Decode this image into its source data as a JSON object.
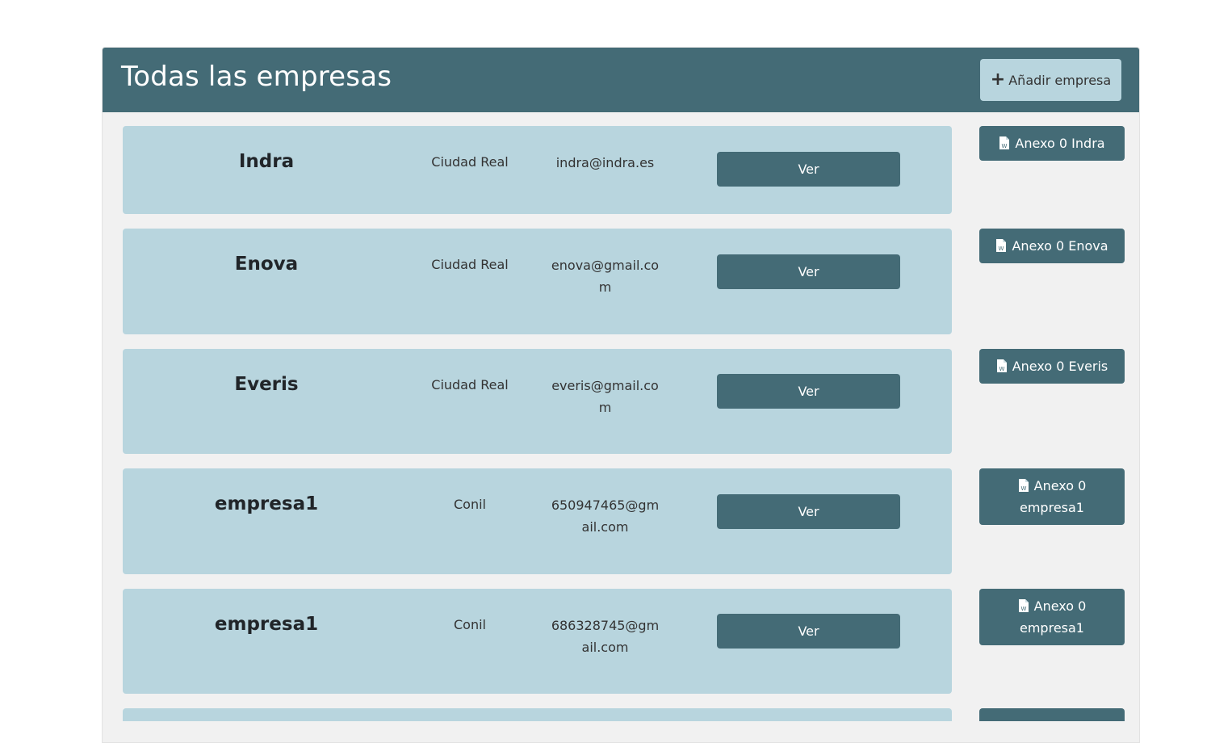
{
  "header": {
    "title": "Todas las empresas",
    "add_label": "Añadir empresa"
  },
  "companies": [
    {
      "name": "Indra",
      "city": "Ciudad Real",
      "email": "indra@indra.es",
      "view_label": "Ver",
      "annex_label": "Anexo 0 Indra"
    },
    {
      "name": "Enova",
      "city": "Ciudad Real",
      "email": "enova@gmail.com",
      "view_label": "Ver",
      "annex_label": "Anexo 0 Enova"
    },
    {
      "name": "Everis",
      "city": "Ciudad Real",
      "email": "everis@gmail.com",
      "view_label": "Ver",
      "annex_label": "Anexo 0 Everis"
    },
    {
      "name": "empresa1",
      "city": "Conil",
      "email": "650947465@gmail.com",
      "view_label": "Ver",
      "annex_label": "Anexo 0 empresa1"
    },
    {
      "name": "empresa1",
      "city": "Conil",
      "email": "686328745@gmail.com",
      "view_label": "Ver",
      "annex_label": "Anexo 0 empresa1"
    }
  ],
  "colors": {
    "header": "#446b76",
    "card": "#b8d5de",
    "panel": "#f1f1f1",
    "button": "#446b76"
  },
  "icons": {
    "add": "plus-icon",
    "annex": "word-document-icon"
  }
}
